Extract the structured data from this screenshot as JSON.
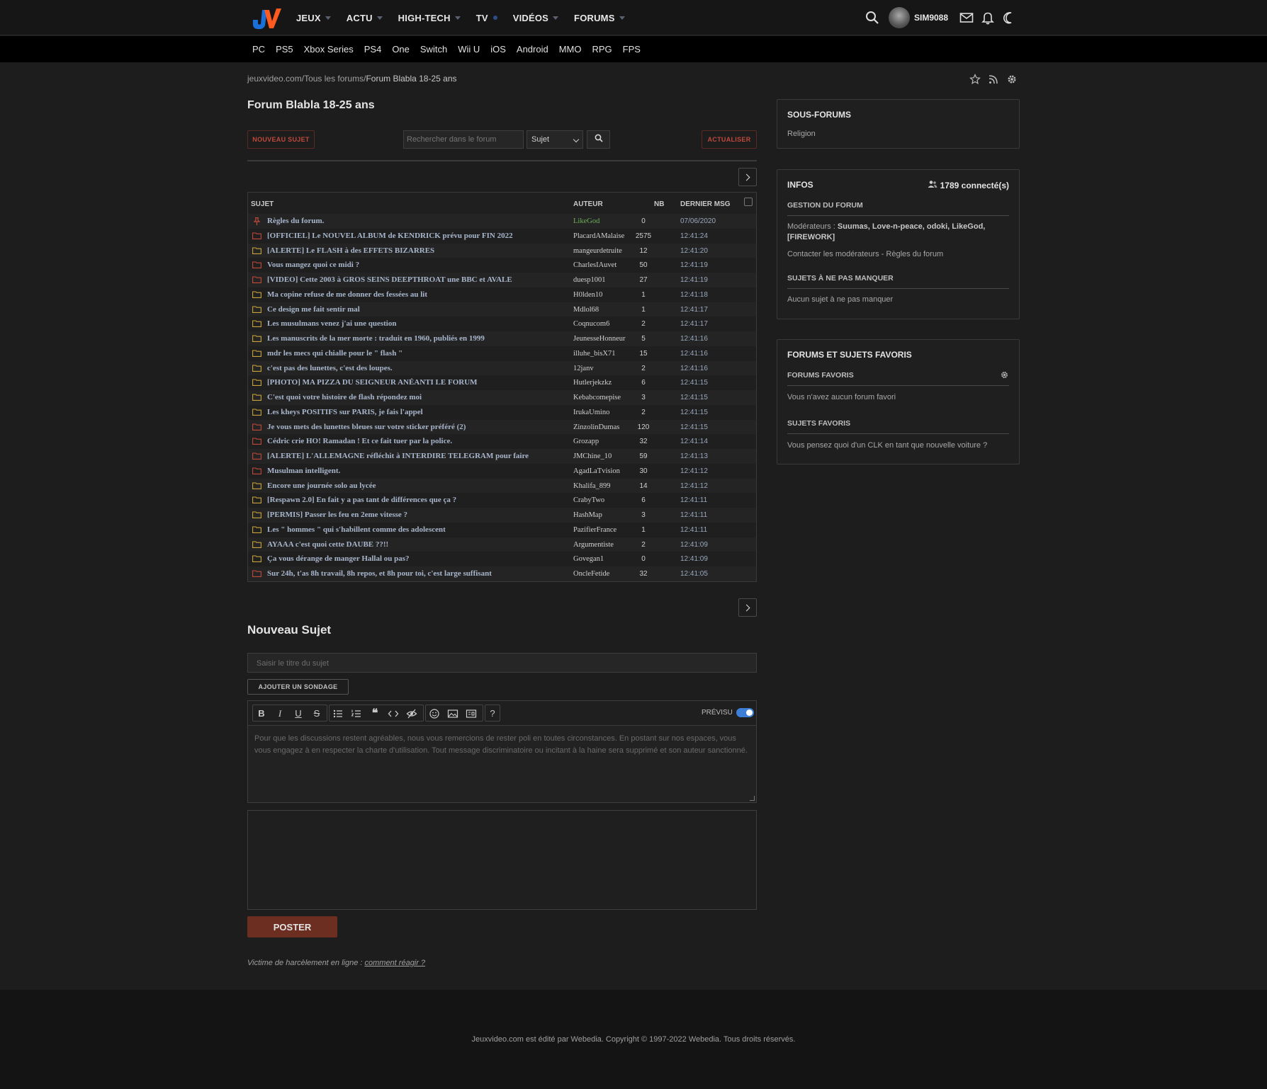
{
  "header": {
    "nav": [
      {
        "label": "JEUX",
        "marker": "caret"
      },
      {
        "label": "ACTU",
        "marker": "caret"
      },
      {
        "label": "HIGH-TECH",
        "marker": "caret"
      },
      {
        "label": "TV",
        "marker": "dot"
      },
      {
        "label": "VIDÉOS",
        "marker": "caret"
      },
      {
        "label": "FORUMS",
        "marker": "caret"
      }
    ],
    "username": "SIM9088",
    "icons": [
      "search-icon",
      "mail-icon",
      "bell-icon",
      "moon-icon"
    ]
  },
  "subnav": [
    "PC",
    "PS5",
    "Xbox Series",
    "PS4",
    "One",
    "Switch",
    "Wii U",
    "iOS",
    "Android",
    "MMO",
    "RPG",
    "FPS"
  ],
  "breadcrumb": {
    "home": "jeuxvideo.com",
    "sep1": "/",
    "forums": "Tous les forums",
    "sep2": "/",
    "current": "Forum Blabla 18-25 ans"
  },
  "page_title": "Forum Blabla 18-25 ans",
  "actions": {
    "new_topic": "NOUVEAU SUJET",
    "search_placeholder": "Rechercher dans le forum",
    "search_scope": "Sujet",
    "refresh": "ACTUALISER"
  },
  "table": {
    "headers": {
      "subject": "SUJET",
      "author": "AUTEUR",
      "nb": "NB",
      "last": "DERNIER MSG"
    },
    "rows": [
      {
        "icon": "pin",
        "subject": "Règles du forum.",
        "author": "LikeGod",
        "nb": "0",
        "last": "07/06/2020",
        "author_color": "#6fae5a"
      },
      {
        "icon": "folder-red",
        "subject": "[OFFICIEL] Le NOUVEL ALBUM de KENDRICK prévu pour FIN 2022",
        "author": "PlacardAMalaise",
        "nb": "2575",
        "last": "12:41:24"
      },
      {
        "icon": "folder",
        "subject": "[ALERTE] Le FLASH à des EFFETS BIZARRES",
        "author": "mangeurdetruite",
        "nb": "12",
        "last": "12:41:20"
      },
      {
        "icon": "folder-red",
        "subject": "Vous mangez quoi ce midi ?",
        "author": "CharlesIAuvet",
        "nb": "50",
        "last": "12:41:19"
      },
      {
        "icon": "folder-red",
        "subject": "[VIDEO] Cette 2003 à GROS SEINS DEEPTHROAT une BBC et AVALE",
        "author": "duesp1001",
        "nb": "27",
        "last": "12:41:19"
      },
      {
        "icon": "folder",
        "subject": "Ma copine refuse de me donner des fessées au lit",
        "author": "H0lden10",
        "nb": "1",
        "last": "12:41:18"
      },
      {
        "icon": "folder",
        "subject": "Ce design me fait sentir mal",
        "author": "Mdlol68",
        "nb": "1",
        "last": "12:41:17"
      },
      {
        "icon": "folder",
        "subject": "Les musulmans venez j'ai une question",
        "author": "Coqnucom6",
        "nb": "2",
        "last": "12:41:17"
      },
      {
        "icon": "folder",
        "subject": "Les manuscrits de la mer morte : traduit en 1960, publiés en 1999",
        "author": "JeunesseHonneur",
        "nb": "5",
        "last": "12:41:16"
      },
      {
        "icon": "folder",
        "subject": "mdr les mecs qui chialle pour le \" flash \"",
        "author": "illuhe_bisX71",
        "nb": "15",
        "last": "12:41:16"
      },
      {
        "icon": "folder",
        "subject": "c'est pas des lunettes, c'est des loupes.",
        "author": "12janv",
        "nb": "2",
        "last": "12:41:16"
      },
      {
        "icon": "folder",
        "subject": "[PHOTO] MA PIZZA DU SEIGNEUR ANÉANTI LE FORUM",
        "author": "Hutlerjekzkz",
        "nb": "6",
        "last": "12:41:15"
      },
      {
        "icon": "folder",
        "subject": "C'est quoi votre histoire de flash répondez moi",
        "author": "Kebabcomepise",
        "nb": "3",
        "last": "12:41:15"
      },
      {
        "icon": "folder",
        "subject": "Les kheys POSITIFS sur PARIS, je fais l'appel",
        "author": "IrukaUmino",
        "nb": "2",
        "last": "12:41:15"
      },
      {
        "icon": "folder-red",
        "subject": "Je vous mets des lunettes bleues sur votre sticker préféré (2)",
        "author": "ZinzolinDumas",
        "nb": "120",
        "last": "12:41:15"
      },
      {
        "icon": "folder-red",
        "subject": "Cédric crie HO! Ramadan ! Et ce fait tuer par la police.",
        "author": "Grozapp",
        "nb": "32",
        "last": "12:41:14"
      },
      {
        "icon": "folder-red",
        "subject": "[ALERTE] L'ALLEMAGNE réfléchit à INTERDIRE TELEGRAM pour faire face au ...",
        "author": "JMChine_10",
        "nb": "59",
        "last": "12:41:13"
      },
      {
        "icon": "folder-red",
        "subject": "Musulman intelligent.",
        "author": "AgadLaTvision",
        "nb": "30",
        "last": "12:41:12"
      },
      {
        "icon": "folder",
        "subject": "Encore une journée solo au lycée",
        "author": "Khalifa_899",
        "nb": "14",
        "last": "12:41:12"
      },
      {
        "icon": "folder",
        "subject": "[Respawn 2.0] En fait y a pas tant de différences que ça ?",
        "author": "CrabyTwo",
        "nb": "6",
        "last": "12:41:11"
      },
      {
        "icon": "folder",
        "subject": "[PERMIS] Passer les feu en 2eme vitesse ?",
        "author": "HashMap",
        "nb": "3",
        "last": "12:41:11"
      },
      {
        "icon": "folder",
        "subject": "Les \" hommes \" qui s'habillent comme des adolescent",
        "author": "PazifierFrance",
        "nb": "1",
        "last": "12:41:11"
      },
      {
        "icon": "folder",
        "subject": "AYAAA c'est quoi cette DAUBE ??!!",
        "author": "Argumentiste",
        "nb": "2",
        "last": "12:41:09"
      },
      {
        "icon": "folder",
        "subject": "Ça vous dérange de manger Hallal ou pas?",
        "author": "Govegan1",
        "nb": "0",
        "last": "12:41:09"
      },
      {
        "icon": "folder-red",
        "subject": "Sur 24h, t'as 8h travail, 8h repos, et 8h pour toi, c'est large suffisant",
        "author": "OncleFetide",
        "nb": "32",
        "last": "12:41:05"
      }
    ]
  },
  "new_topic": {
    "title": "Nouveau Sujet",
    "title_placeholder": "Saisir le titre du sujet",
    "poll_button": "AJOUTER UN SONDAGE",
    "preview_label": "PRÉVISU",
    "editor_placeholder": "Pour que les discussions restent agréables, nous vous remercions de rester poli en toutes circonstances. En postant sur nos espaces, vous vous engagez à en respecter la charte d'utilisation. Tout message discriminatoire ou incitant à la haine sera supprimé et son auteur sanctionné.",
    "post_button": "POSTER",
    "harassment_text": "Victime de harcèlement en ligne : ",
    "harassment_link": "comment réagir ?"
  },
  "sidebar": {
    "subforums": {
      "title": "SOUS-FORUMS",
      "items": [
        "Religion"
      ]
    },
    "infos": {
      "title": "INFOS",
      "connected": "1789 connecté(s)",
      "management_title": "GESTION DU FORUM",
      "moderators_label": "Modérateurs : ",
      "moderators": "Suumas, Love-n-peace, odoki, LikeGod, [FIREWORK]",
      "contact": "Contacter les modérateurs",
      "rules_sep": " - ",
      "rules": "Règles du forum",
      "must_see_title": "SUJETS À NE PAS MANQUER",
      "must_see_text": "Aucun sujet à ne pas manquer"
    },
    "favorites": {
      "title": "FORUMS ET SUJETS FAVORIS",
      "forums_title": "FORUMS FAVORIS",
      "forums_text": "Vous n'avez aucun forum favori",
      "topics_title": "SUJETS FAVORIS",
      "topics_text": "Vous pensez quoi d'un CLK en tant que nouvelle voiture ?"
    }
  },
  "footer": "Jeuxvideo.com est édité par Webedia. Copyright © 1997-2022 Webedia. Tous droits réservés.",
  "colors": {
    "accent": "#c0493a",
    "poster_bg": "#6d2e22",
    "link": "#a8b6cc",
    "logo_orange": "#ff5a1f",
    "logo_blue": "#1a6fd8"
  }
}
